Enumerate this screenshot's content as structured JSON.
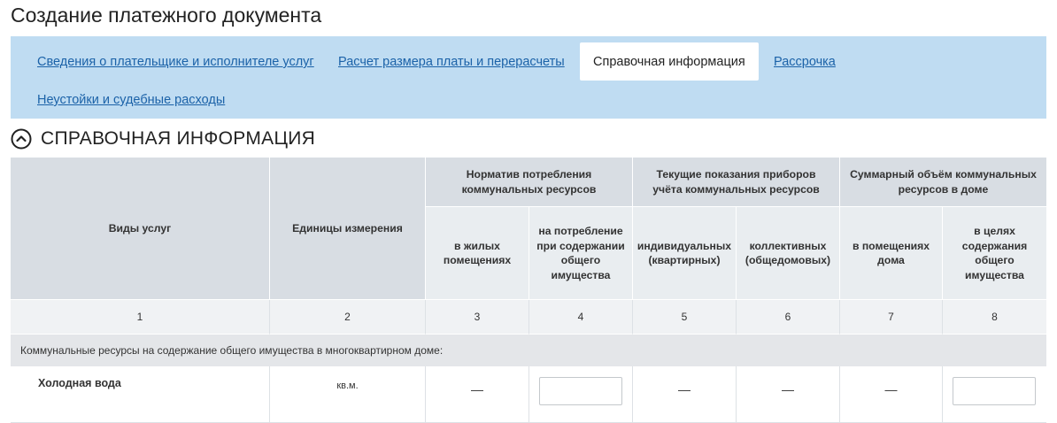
{
  "page": {
    "title": "Создание платежного документа"
  },
  "tabs": [
    {
      "label": "Сведения о плательщике и исполнителе услуг",
      "active": false
    },
    {
      "label": "Расчет размера платы и перерасчеты",
      "active": false
    },
    {
      "label": "Справочная информация",
      "active": true
    },
    {
      "label": "Рассрочка",
      "active": false
    },
    {
      "label": "Неустойки и судебные расходы",
      "active": false
    }
  ],
  "section": {
    "title": "СПРАВОЧНАЯ ИНФОРМАЦИЯ",
    "icon": "chevron-up-circle-icon"
  },
  "table": {
    "headers": {
      "services": "Виды услуг",
      "units": "Единицы измерения",
      "norm_group": "Норматив потребления коммунальных ресурсов",
      "meters_group": "Текущие показания приборов учёта коммунальных ресурсов",
      "total_group": "Суммарный объём коммунальных ресурсов в доме",
      "norm_living": "в жилых помещениях",
      "norm_common": "на потребление при содержании общего имущества",
      "meters_individual": "индивидуальных (квартирных)",
      "meters_collective": "коллективных (общедомовых)",
      "total_premises": "в помещениях дома",
      "total_common": "в целях содержания общего имущества"
    },
    "column_numbers": [
      "1",
      "2",
      "3",
      "4",
      "5",
      "6",
      "7",
      "8"
    ],
    "group_row": "Коммунальные ресурсы на содержание общего имущества в многоквартирном доме:",
    "rows": [
      {
        "service": "Холодная вода",
        "unit": "кв.м.",
        "norm_living": "—",
        "norm_common_input": "",
        "meters_individual": "—",
        "meters_collective": "—",
        "total_premises": "—",
        "total_common_input": ""
      }
    ]
  },
  "colors": {
    "tab_bar": "#bfdcf2",
    "link": "#1b62a8",
    "header_bg": "#d8dde3",
    "subheader_bg": "#e9edf0"
  }
}
